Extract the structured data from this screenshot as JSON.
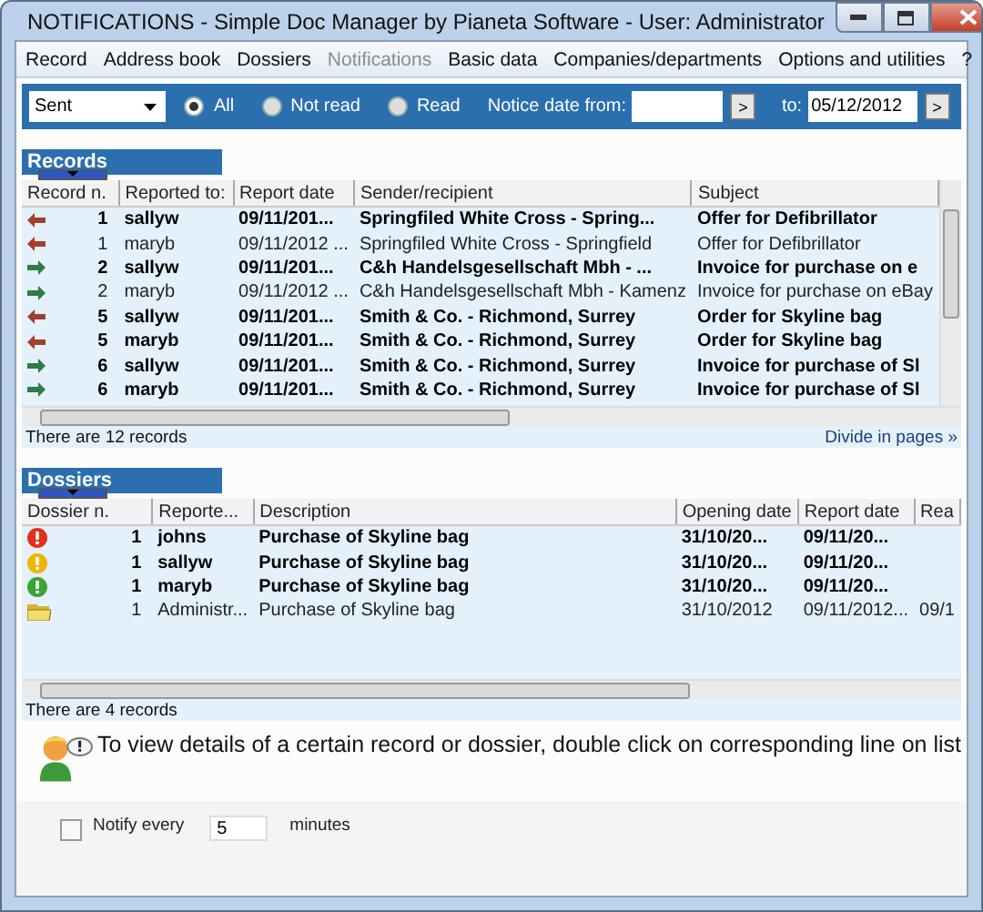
{
  "window": {
    "title": "NOTIFICATIONS - Simple Doc Manager by Pianeta Software - User: Administrator"
  },
  "menu": [
    {
      "label": "Record",
      "disabled": false
    },
    {
      "label": "Address book",
      "disabled": false
    },
    {
      "label": "Dossiers",
      "disabled": false
    },
    {
      "label": "Notifications",
      "disabled": true
    },
    {
      "label": "Basic data",
      "disabled": false
    },
    {
      "label": "Companies/departments",
      "disabled": false
    },
    {
      "label": "Options and utilities",
      "disabled": false
    },
    {
      "label": "?",
      "disabled": false
    }
  ],
  "filter": {
    "mailbox": "Sent",
    "radios": [
      {
        "label": "All",
        "selected": true
      },
      {
        "label": "Not read",
        "selected": false
      },
      {
        "label": "Read",
        "selected": false
      }
    ],
    "date_from_label": "Notice date from:",
    "date_from_button": ">",
    "date_to_label": "to:",
    "date_to": "05/12/2012",
    "date_to_button": ">"
  },
  "records": {
    "title": "Records",
    "columns": [
      "Record n.",
      "Reported to:",
      "Report date",
      "Sender/recipient",
      "Subject"
    ],
    "rows": [
      {
        "kind": "incoming",
        "number": "1",
        "reported_to": "sallyw",
        "date": "09/11/201...",
        "sender": "Springfiled White Cross - Spring...",
        "subject": "Offer for Defibrillator",
        "read": false
      },
      {
        "kind": "incoming",
        "number": "1",
        "reported_to": "maryb",
        "date": "09/11/2012 ...",
        "sender": "Springfiled White Cross - Springfield",
        "subject": "Offer for Defibrillator",
        "read": true
      },
      {
        "kind": "outgoing",
        "number": "2",
        "reported_to": "sallyw",
        "date": "09/11/201...",
        "sender": "C&h Handelsgesellschaft Mbh - ...",
        "subject": "Invoice for purchase on e",
        "read": false
      },
      {
        "kind": "outgoing",
        "number": "2",
        "reported_to": "maryb",
        "date": "09/11/2012 ...",
        "sender": "C&h Handelsgesellschaft Mbh - Kamenz",
        "subject": "Invoice for purchase on eBay",
        "read": true
      },
      {
        "kind": "incoming",
        "number": "5",
        "reported_to": "sallyw",
        "date": "09/11/201...",
        "sender": "Smith & Co. - Richmond, Surrey",
        "subject": "Order for Skyline bag",
        "read": false
      },
      {
        "kind": "incoming",
        "number": "5",
        "reported_to": "maryb",
        "date": "09/11/201...",
        "sender": "Smith & Co. - Richmond, Surrey",
        "subject": "Order for Skyline bag",
        "read": false
      },
      {
        "kind": "outgoing",
        "number": "6",
        "reported_to": "sallyw",
        "date": "09/11/201...",
        "sender": "Smith & Co. - Richmond, Surrey",
        "subject": "Invoice for purchase of Sl",
        "read": false
      },
      {
        "kind": "outgoing",
        "number": "6",
        "reported_to": "maryb",
        "date": "09/11/201...",
        "sender": "Smith & Co. - Richmond, Surrey",
        "subject": "Invoice for purchase of Sl",
        "read": false
      }
    ],
    "count": "There are 12 records",
    "link": "Divide in pages »"
  },
  "dossiers": {
    "title": "Dossiers",
    "columns": [
      "Dossier n.",
      "Reporte...",
      "Description",
      "Opening date",
      "Report date",
      "Rea"
    ],
    "rows": [
      {
        "kind": "alert",
        "color": "#e0301e",
        "number": "1",
        "reported_to": "johns",
        "description": "Purchase of Skyline bag",
        "opening_date": "31/10/20...",
        "report_date": "09/11/20...",
        "read": false
      },
      {
        "kind": "alert",
        "color": "#f0b400",
        "number": "1",
        "reported_to": "sallyw",
        "description": "Purchase of Skyline bag",
        "opening_date": "31/10/20...",
        "report_date": "09/11/20...",
        "read": false
      },
      {
        "kind": "alert",
        "color": "#3aa335",
        "number": "1",
        "reported_to": "maryb",
        "description": "Purchase of Skyline bag",
        "opening_date": "31/10/20...",
        "report_date": "09/11/20...",
        "read": false
      },
      {
        "kind": "folder",
        "number": "1",
        "reported_to": "Administr...",
        "description": "Purchase of Skyline bag",
        "opening_date": "31/10/2012",
        "report_date": "09/11/2012...",
        "column_6": "09/1",
        "read": true
      }
    ],
    "count": "There are 4 records"
  },
  "info": "To view details of a certain record or dossier, double click on corresponding line on list",
  "notify": {
    "checked": false,
    "label": "Notify every",
    "value": "5",
    "unit": "minutes"
  }
}
